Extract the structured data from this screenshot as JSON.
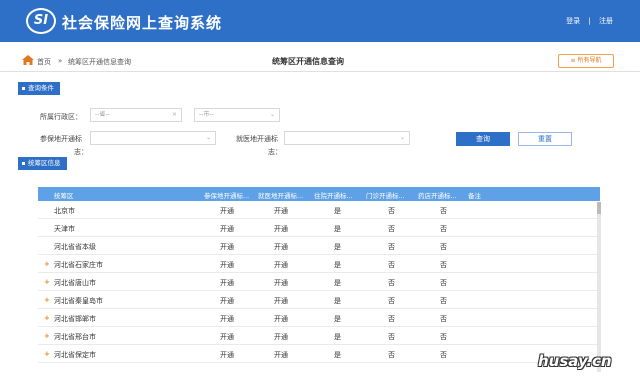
{
  "header": {
    "logo_text": "SI",
    "title": "社会保险网上查询系统",
    "login": "登录",
    "separator": "|",
    "register": "注册"
  },
  "breadcrumb": {
    "home": "首页",
    "sep": "»",
    "current": "统筹区开通信息查询"
  },
  "page_title": "统筹区开通信息查询",
  "all_nav": "≡ 所有导航",
  "query": {
    "section_label": "查询条件",
    "region_label": "所属行政区：",
    "province_placeholder": "--省--",
    "city_placeholder": "--市--",
    "insured_label": "参保地开通标",
    "insured_label2": "志：",
    "medical_label": "就医地开通标",
    "medical_label2": "志：",
    "search_button": "查询",
    "reset_button": "重置"
  },
  "info": {
    "section_label": "统筹区信息"
  },
  "table": {
    "columns": [
      "统筹区",
      "参保地开通标...",
      "就医地开通标...",
      "住院开通标...",
      "门诊开通标...",
      "药店开通标...",
      "备注"
    ],
    "rows": [
      {
        "expand": "",
        "name": "北京市",
        "c1": "开通",
        "c2": "开通",
        "c3": "是",
        "c4": "否",
        "c5": "否"
      },
      {
        "expand": "",
        "name": "天津市",
        "c1": "开通",
        "c2": "开通",
        "c3": "是",
        "c4": "否",
        "c5": "否"
      },
      {
        "expand": "",
        "name": "河北省省本级",
        "c1": "开通",
        "c2": "开通",
        "c3": "是",
        "c4": "否",
        "c5": "否"
      },
      {
        "expand": "+",
        "name": "河北省石家庄市",
        "c1": "开通",
        "c2": "开通",
        "c3": "是",
        "c4": "否",
        "c5": "否"
      },
      {
        "expand": "+",
        "name": "河北省唐山市",
        "c1": "开通",
        "c2": "开通",
        "c3": "是",
        "c4": "否",
        "c5": "否"
      },
      {
        "expand": "+",
        "name": "河北省秦皇岛市",
        "c1": "开通",
        "c2": "开通",
        "c3": "是",
        "c4": "否",
        "c5": "否"
      },
      {
        "expand": "+",
        "name": "河北省邯郸市",
        "c1": "开通",
        "c2": "开通",
        "c3": "是",
        "c4": "否",
        "c5": "否"
      },
      {
        "expand": "+",
        "name": "河北省邢台市",
        "c1": "开通",
        "c2": "开通",
        "c3": "是",
        "c4": "否",
        "c5": "否"
      },
      {
        "expand": "+",
        "name": "河北省保定市",
        "c1": "开通",
        "c2": "开通",
        "c3": "是",
        "c4": "否",
        "c5": "否"
      }
    ]
  },
  "watermark": "husay.cn",
  "colors": {
    "primary": "#2e6fc7",
    "table_header": "#5ea1e6",
    "accent": "#e07820"
  }
}
